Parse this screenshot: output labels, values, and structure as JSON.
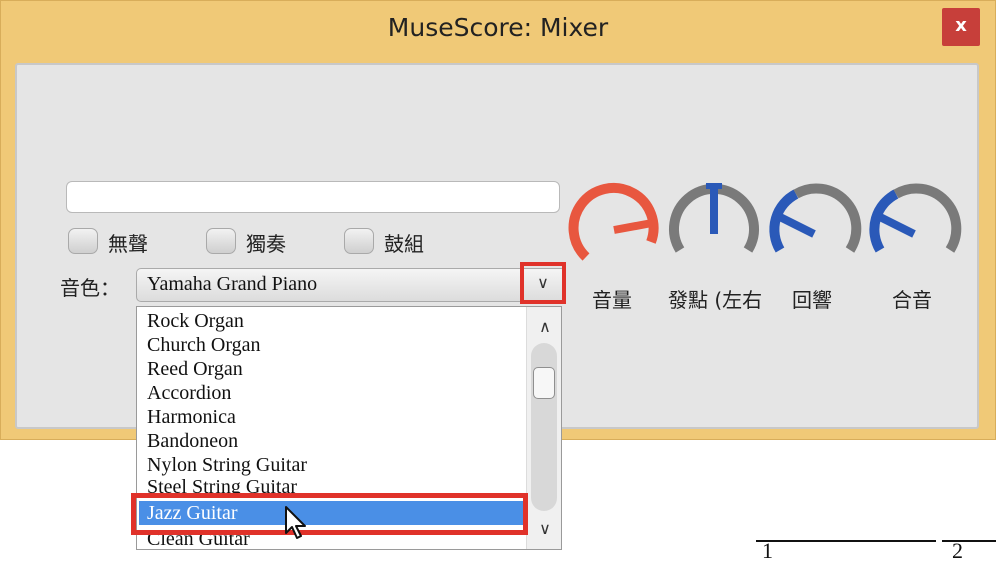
{
  "window": {
    "title": "MuseScore: Mixer",
    "close_label": "x"
  },
  "channel": {
    "name_value": "",
    "checkboxes": [
      {
        "label": "無聲",
        "checked": false
      },
      {
        "label": "獨奏",
        "checked": false
      },
      {
        "label": "鼓組",
        "checked": false
      }
    ],
    "sound_label": "音色：",
    "sound_selected": "Yamaha Grand Piano",
    "dropdown_arrow": "∨"
  },
  "sound_list": {
    "items": [
      "Rock Organ",
      "Church Organ",
      "Reed Organ",
      "Accordion",
      "Harmonica",
      "Bandoneon",
      "Nylon String Guitar",
      "Steel String Guitar",
      "Jazz Guitar",
      "Clean Guitar"
    ],
    "selected_index": 8,
    "scroll_up": "∧",
    "scroll_down": "∨"
  },
  "knobs": [
    {
      "label": "音量",
      "color": "#e8573f",
      "icon": "volume-knob-icon"
    },
    {
      "label": "發點 (左右",
      "color": "#2a59b8",
      "icon": "pan-knob-icon"
    },
    {
      "label": "回響",
      "color": "#2a59b8",
      "icon": "reverb-knob-icon"
    },
    {
      "label": "合音",
      "color": "#2a59b8",
      "icon": "chorus-knob-icon"
    }
  ],
  "background_score": {
    "measure_1": "1",
    "measure_2": "2"
  },
  "colors": {
    "window_frame": "#f0c977",
    "panel": "#e5e5e5",
    "highlight": "#e0322a",
    "selection": "#4a8fe6",
    "close_button": "#c73f3a"
  }
}
